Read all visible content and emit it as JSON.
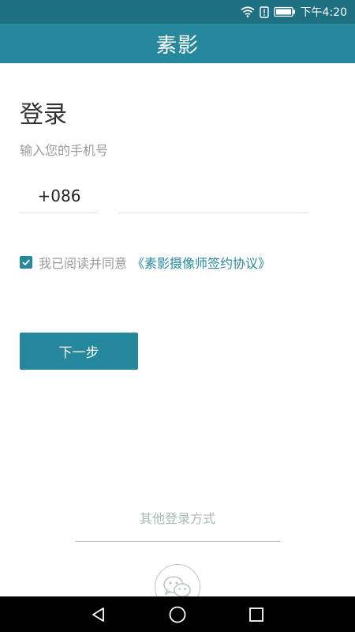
{
  "status_bar": {
    "time": "下午4:20",
    "icons": [
      "wifi-icon",
      "notification-icon",
      "battery-icon"
    ]
  },
  "app_bar": {
    "title": "素影"
  },
  "login": {
    "title": "登录",
    "phone_hint": "输入您的手机号",
    "country_code": "+086",
    "phone_value": "",
    "agreement": {
      "checked": true,
      "text": "我已阅读并同意",
      "link": "《素影摄像师签约协议》"
    },
    "next_button": "下一步"
  },
  "other_login": {
    "label": "其他登录方式",
    "options": [
      "wechat-icon"
    ]
  },
  "nav_bar": {
    "buttons": [
      "back-icon",
      "home-icon",
      "recents-icon"
    ]
  },
  "colors": {
    "status_bar": "#1f6f82",
    "primary": "#25889d",
    "hint_text": "#9a9a9a",
    "divider": "#b7c7cc"
  }
}
